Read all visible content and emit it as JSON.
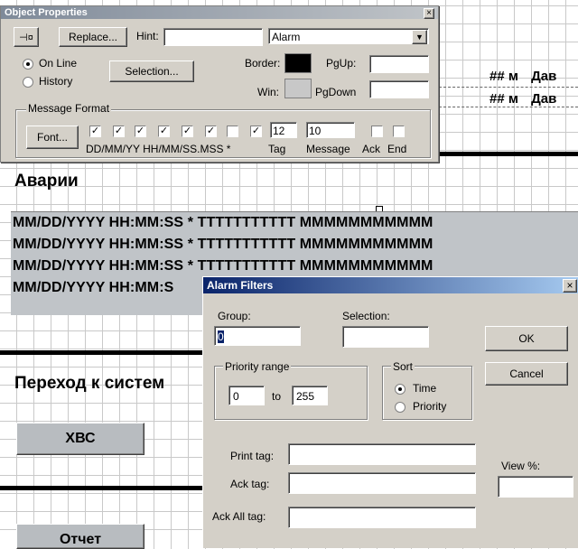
{
  "object_properties": {
    "title": "Object Properties",
    "close_glyph": "×",
    "replace_label": "Replace...",
    "hint_label": "Hint:",
    "hint_value": "",
    "type_select_value": "Alarm",
    "on_line_label": "On Line",
    "history_label": "History",
    "selection_label": "Selection...",
    "border_label": "Border:",
    "win_label": "Win:",
    "pgup_label": "PgUp:",
    "pgdown_label": "PgDown",
    "message_format_label": "Message Format",
    "font_label": "Font...",
    "format_caption": "DD/MM/YY HH/MM/SS.MSS *",
    "tag_label": "Tag",
    "tag_value": "12",
    "message_label": "Message",
    "message_value": "10",
    "ack_label": "Ack",
    "end_label": "End",
    "colors": {
      "border_swatch": "#000000",
      "win_swatch": "#c8c8c8"
    }
  },
  "canvas": {
    "right_top_rows": [
      {
        "hash": "## м",
        "text": "Дав"
      },
      {
        "hash": "## м",
        "text": "Дав"
      }
    ],
    "alarms_heading": "Аварии",
    "alarm_rows": [
      "MM/DD/YYYY HH:MM:SS  * TTTTTTTTTTT MMMMMMMMMMM",
      "MM/DD/YYYY HH:MM:SS  * TTTTTTTTTTT MMMMMMMMMMM",
      "MM/DD/YYYY HH:MM:SS  * TTTTTTTTTTT MMMMMMMMMMM",
      "MM/DD/YYYY HH:MM:S"
    ],
    "transition_heading": "Переход к систем",
    "hvs_button": "ХВС",
    "report_button": "Отчет"
  },
  "alarm_filters": {
    "title": "Alarm Filters",
    "close_glyph": "×",
    "group_label": "Group:",
    "group_value": "0",
    "selection_label": "Selection:",
    "selection_value": "",
    "ok_label": "OK",
    "cancel_label": "Cancel",
    "priority_range_label": "Priority range",
    "priority_from": "0",
    "to_label": "to",
    "priority_to": "255",
    "sort_label": "Sort",
    "sort_time": "Time",
    "sort_priority": "Priority",
    "print_tag_label": "Print tag:",
    "ack_tag_label": "Ack tag:",
    "ack_all_tag_label": "Ack All tag:",
    "view_percent_label": "View %:"
  }
}
